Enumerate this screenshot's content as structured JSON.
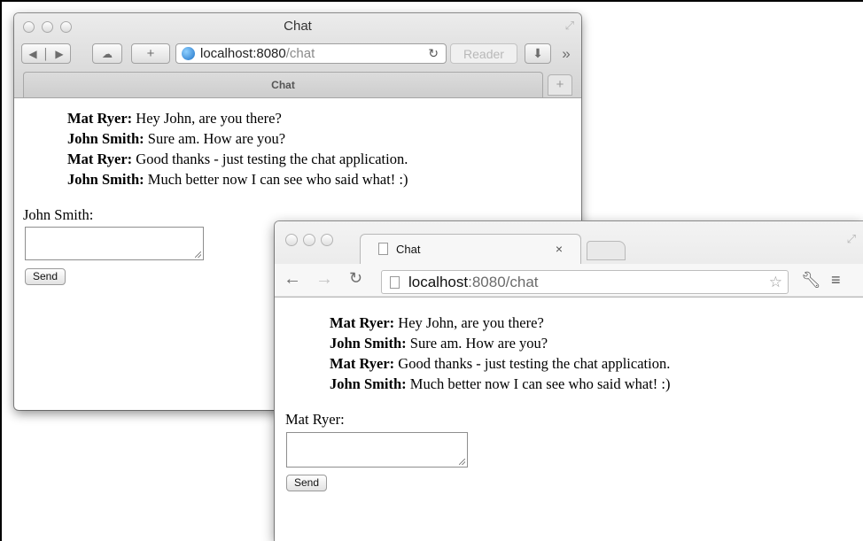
{
  "safari": {
    "title": "Chat",
    "address_host": "localhost:8080",
    "address_path": "/chat",
    "reader_label": "Reader",
    "tab_title": "Chat",
    "new_tab_symbol": "+",
    "add_symbol": "+",
    "overflow_symbol": "»",
    "messages": [
      {
        "name": "Mat Ryer:",
        "text": " Hey John, are you there?"
      },
      {
        "name": "John Smith:",
        "text": " Sure am. How are you?"
      },
      {
        "name": "Mat Ryer:",
        "text": " Good thanks - just testing the chat application."
      },
      {
        "name": "John Smith:",
        "text": " Much better now I can see who said what! :)"
      }
    ],
    "user_label": "John Smith:",
    "message_value": "",
    "send_label": "Send"
  },
  "chrome": {
    "tab_title": "Chat",
    "tab_close": "×",
    "address_host": "localhost",
    "address_path": ":8080/chat",
    "messages": [
      {
        "name": "Mat Ryer:",
        "text": " Hey John, are you there?"
      },
      {
        "name": "John Smith:",
        "text": " Sure am. How are you?"
      },
      {
        "name": "Mat Ryer:",
        "text": " Good thanks - just testing the chat application."
      },
      {
        "name": "John Smith:",
        "text": " Much better now I can see who said what! :)"
      }
    ],
    "user_label": "Mat Ryer:",
    "message_value": "",
    "send_label": "Send"
  }
}
